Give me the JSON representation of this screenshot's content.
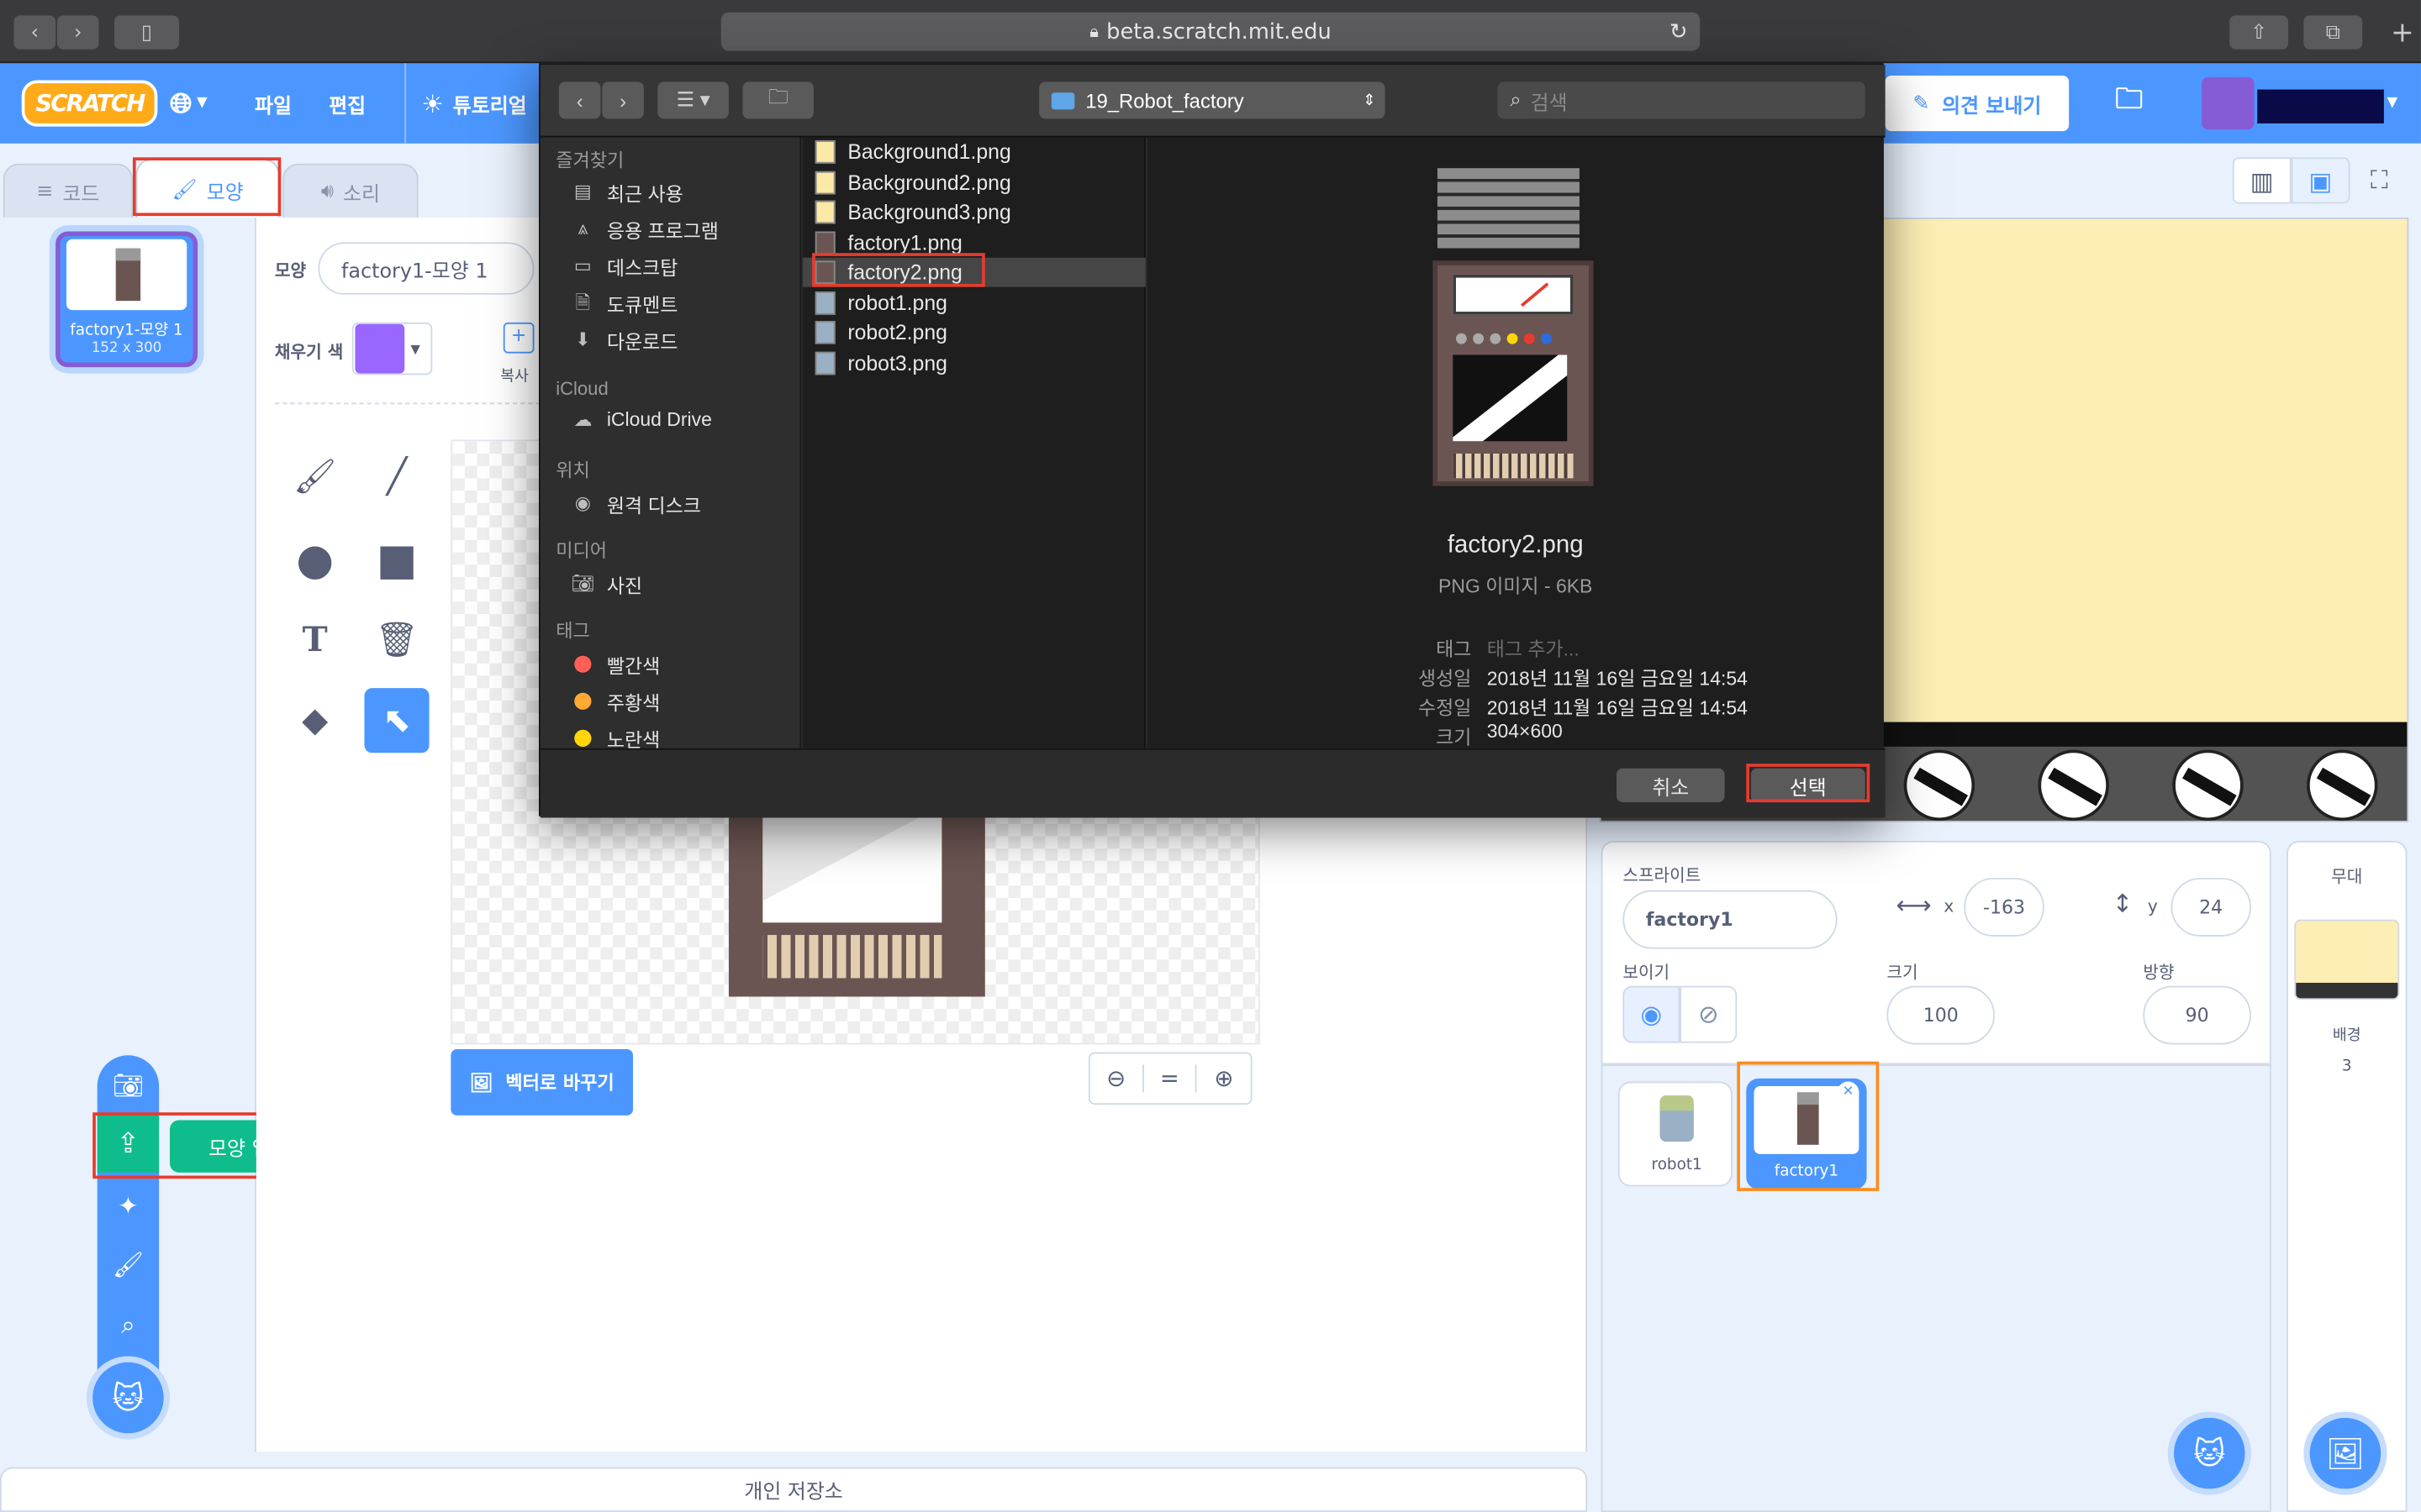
{
  "browser": {
    "url": "beta.scratch.mit.edu"
  },
  "menubar": {
    "logo": "SCRATCH",
    "file": "파일",
    "edit": "편집",
    "tutorials": "튜토리얼",
    "feedback": "의견 보내기",
    "colors": {
      "bar": "#4c97ff"
    }
  },
  "tabs": [
    {
      "label": "코드"
    },
    {
      "label": "모양"
    },
    {
      "label": "소리"
    }
  ],
  "costume_list": [
    {
      "index": "1",
      "name": "factory1-모양 1",
      "size": "152 x 300"
    }
  ],
  "paint_editor": {
    "costume_label": "모양",
    "costume_name": "factory1-모양 1",
    "fill_label": "채우기 색",
    "fill_color": "#9966ff",
    "copy_label": "복사",
    "convert_button": "벡터로 바꾸기",
    "zoom_reset": "="
  },
  "costume_menu": {
    "tooltip": "모양 업로드하기"
  },
  "sprite_info": {
    "sprite_label": "스프라이트",
    "sprite_name": "factory1",
    "x_label": "x",
    "x": "-163",
    "y_label": "y",
    "y": "24",
    "show_label": "보이기",
    "size_label": "크기",
    "size": "100",
    "direction_label": "방향",
    "direction": "90"
  },
  "sprites": [
    {
      "name": "robot1"
    },
    {
      "name": "factory1"
    }
  ],
  "stage_panel": {
    "title": "무대",
    "backdrops_label": "배경",
    "backdrops_count": "3"
  },
  "backpack": {
    "label": "개인 저장소"
  },
  "dialog": {
    "folder": "19_Robot_factory",
    "search_placeholder": "검색",
    "sidebar": {
      "favorites_title": "즐겨찾기",
      "favorites": [
        "최근 사용",
        "응용 프로그램",
        "데스크탑",
        "도큐멘트",
        "다운로드"
      ],
      "icloud_title": "iCloud",
      "icloud": [
        "iCloud Drive"
      ],
      "locations_title": "위치",
      "locations": [
        "원격 디스크"
      ],
      "media_title": "미디어",
      "media": [
        "사진"
      ],
      "tags_title": "태그",
      "tags": [
        {
          "label": "빨간색",
          "color": "#ff5f57"
        },
        {
          "label": "주황색",
          "color": "#ffaa33"
        },
        {
          "label": "노란색",
          "color": "#ffd60a"
        }
      ]
    },
    "files": [
      "Background1.png",
      "Background2.png",
      "Background3.png",
      "factory1.png",
      "factory2.png",
      "robot1.png",
      "robot2.png",
      "robot3.png"
    ],
    "selected_file": "factory2.png",
    "preview": {
      "name": "factory2.png",
      "kind": "PNG 이미지 - 6KB",
      "tags_label": "태그",
      "tags_placeholder": "태그 추가...",
      "created_label": "생성일",
      "created": "2018년 11월 16일 금요일 14:54",
      "modified_label": "수정일",
      "modified": "2018년 11월 16일 금요일 14:54",
      "size_label": "크기",
      "size": "304×600"
    },
    "cancel": "취소",
    "choose": "선택"
  }
}
